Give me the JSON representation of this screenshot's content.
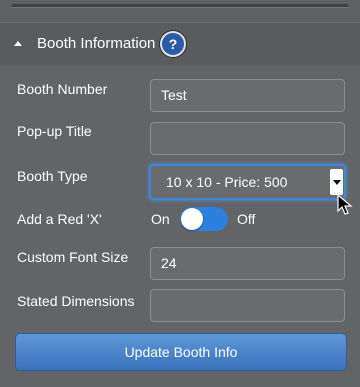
{
  "section": {
    "title": "Booth Information",
    "help_label": "?"
  },
  "fields": {
    "booth_number": {
      "label": "Booth Number",
      "value": "Test"
    },
    "popup_title": {
      "label": "Pop-up Title",
      "value": ""
    },
    "booth_type": {
      "label": "Booth Type",
      "value": "10 x 10 - Price: 500"
    },
    "red_x": {
      "label": "Add a Red 'X'",
      "on_label": "On",
      "off_label": "Off",
      "state": "on"
    },
    "custom_font_size": {
      "label": "Custom Font Size",
      "value": "24"
    },
    "stated_dimensions": {
      "label": "Stated Dimensions",
      "value": ""
    }
  },
  "actions": {
    "update_label": "Update Booth Info"
  },
  "colors": {
    "panel_bg": "#636466",
    "accent": "#2d7fe0",
    "button": "#4a84cc"
  },
  "icons": {
    "caret": "caret-up-icon",
    "help": "help-icon",
    "dropdown": "chevron-down-icon",
    "cursor": "mouse-pointer-icon"
  }
}
